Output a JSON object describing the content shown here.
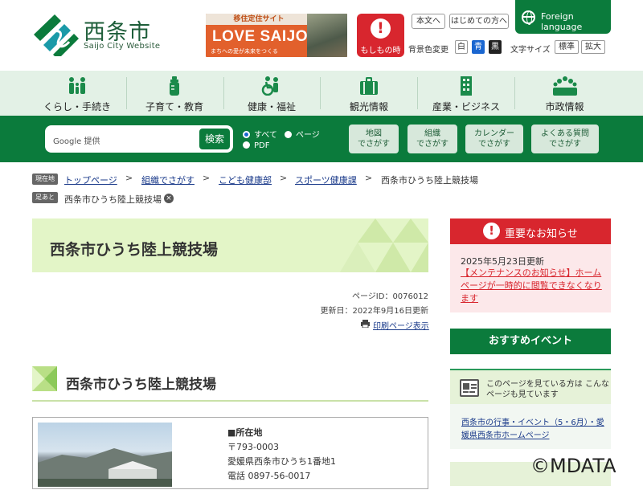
{
  "header": {
    "logo_title": "西条市",
    "logo_subtitle": "Saijo City Website",
    "banner": {
      "top": "移住定住サイト",
      "main": "LOVE SAIJO",
      "sub": "まちへの愛が未来をつくる"
    },
    "emergency_label": "もしもの時",
    "text_only_btn": "本文へ",
    "first_time_btn": "はじめての方へ",
    "foreign_language": "Foreign language",
    "bgcolor_label": "背景色変更",
    "bg_options": [
      "白",
      "青",
      "黒"
    ],
    "fontsize_label": "文字サイズ",
    "font_options": [
      "標準",
      "拡大"
    ]
  },
  "nav": {
    "items": [
      {
        "label": "くらし・手続き",
        "icon": "family-icon"
      },
      {
        "label": "子育て・教育",
        "icon": "baby-bottle-icon"
      },
      {
        "label": "健康・福祉",
        "icon": "wheelchair-icon"
      },
      {
        "label": "観光情報",
        "icon": "suitcase-icon"
      },
      {
        "label": "産業・ビジネス",
        "icon": "building-icon"
      },
      {
        "label": "市政情報",
        "icon": "people-group-icon"
      }
    ]
  },
  "search": {
    "google_label": "Google 提供",
    "button": "検索",
    "radio_all": "すべて",
    "radio_page": "ページ",
    "radio_pdf": "PDF",
    "buttons": [
      {
        "l1": "地図",
        "l2": "でさがす"
      },
      {
        "l1": "組織",
        "l2": "でさがす"
      },
      {
        "l1": "カレンダー",
        "l2": "でさがす"
      },
      {
        "l1": "よくある質問",
        "l2": "でさがす"
      }
    ]
  },
  "breadcrumb": {
    "current_tag": "現在地",
    "items": [
      "トップページ",
      "組織でさがす",
      "こども健康部",
      "スポーツ健康課",
      "西条市ひうち陸上競技場"
    ],
    "history_tag": "足あと",
    "history_item": "西条市ひうち陸上競技場"
  },
  "main": {
    "page_title": "西条市ひうち陸上競技場",
    "page_id": "ページID：0076012",
    "updated": "更新日：2022年9月16日更新",
    "print": "印刷ページ表示",
    "section_title": "西条市ひうち陸上競技場",
    "info": {
      "location_heading": "■所在地",
      "postal": "〒793-0003",
      "address": "愛媛県西条市ひうち1番地1",
      "phone": "電話 0897-56-0017"
    }
  },
  "sidebar": {
    "important_title": "重要なお知らせ",
    "important_date": "2025年5月23日更新",
    "important_link": "【メンテナンスのお知らせ】ホームページが一時的に閲覧できなくなります",
    "events_title": "おすすめイベント",
    "rec_title": "このページを見ている方は こんなページも見ています",
    "rec_link": "西条市の行事・イベント（5・6月）・愛媛県西条市ホームページ"
  },
  "watermark": "©MDATA",
  "colors": {
    "brand_green": "#0b7b3c",
    "alert_red": "#d8262e",
    "light_green": "#e3f5c7"
  }
}
